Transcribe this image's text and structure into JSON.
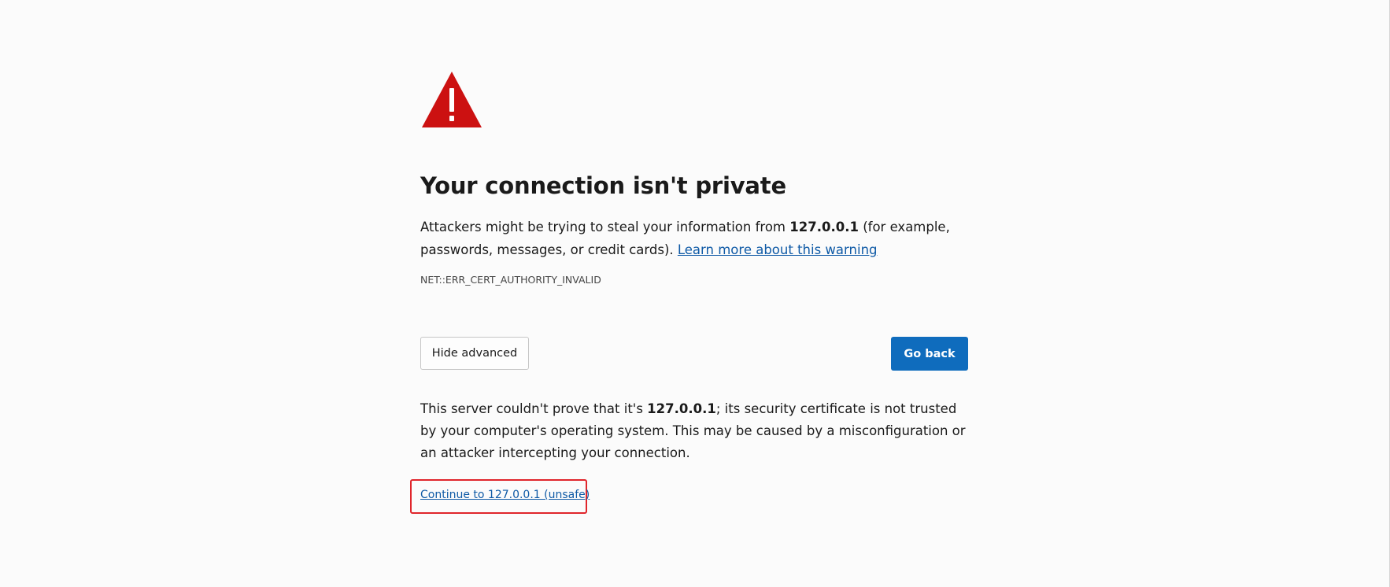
{
  "icon": "warning-triangle-icon",
  "colors": {
    "warning": "#cc1111",
    "primary_button": "#0f6cbd",
    "link": "#0f5aa6",
    "highlight_box": "#e0252b"
  },
  "heading": "Your connection isn't private",
  "description": {
    "before_host": "Attackers might be trying to steal your information from ",
    "host": "127.0.0.1",
    "after_host": " (for example, passwords, messages, or credit cards). ",
    "learn_more": "Learn more about this warning"
  },
  "error_code": "NET::ERR_CERT_AUTHORITY_INVALID",
  "buttons": {
    "hide_advanced": "Hide advanced",
    "go_back": "Go back"
  },
  "details": {
    "before_host": "This server couldn't prove that it's ",
    "host": "127.0.0.1",
    "after_host": "; its security certificate is not trusted by your computer's operating system. This may be caused by a misconfiguration or an attacker intercepting your connection."
  },
  "proceed_link": "Continue to 127.0.0.1 (unsafe)"
}
